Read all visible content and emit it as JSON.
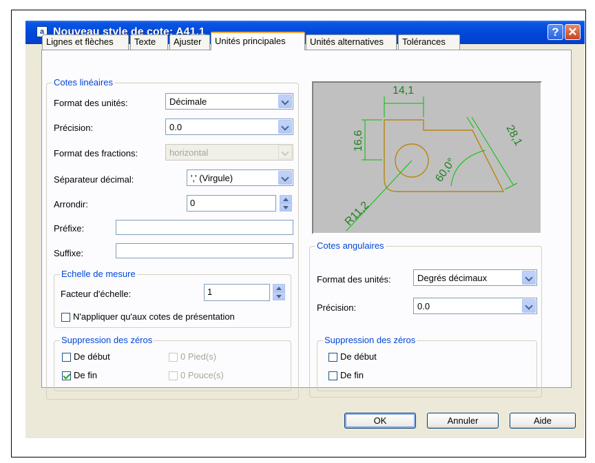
{
  "window": {
    "title": "Nouveau style de cote: A41.1",
    "help_btn": "?",
    "close_btn": "✕",
    "icon_text": "a"
  },
  "tabs": [
    {
      "label": "Lignes et flèches"
    },
    {
      "label": "Texte"
    },
    {
      "label": "Ajuster"
    },
    {
      "label": "Unités principales",
      "active": true
    },
    {
      "label": "Unités alternatives"
    },
    {
      "label": "Tolérances"
    }
  ],
  "linear": {
    "legend": "Cotes linéaires",
    "unit_format_label": "Format des unités:",
    "unit_format_value": "Décimale",
    "precision_label": "Précision:",
    "precision_value": "0.0",
    "fraction_label": "Format des fractions:",
    "fraction_value": "horizontal",
    "decimal_sep_label": "Séparateur décimal:",
    "decimal_sep_value": "',' (Virgule)",
    "round_label": "Arrondir:",
    "round_value": "0",
    "prefix_label": "Préfixe:",
    "prefix_value": "",
    "suffix_label": "Suffixe:",
    "suffix_value": ""
  },
  "scale": {
    "legend": "Echelle de mesure",
    "factor_label": "Facteur d'échelle:",
    "factor_value": "1",
    "layout_only_label": "N'appliquer qu'aux cotes de présentation",
    "layout_only_checked": false
  },
  "linear_zero": {
    "legend": "Suppression des zéros",
    "leading_label": "De début",
    "leading_checked": false,
    "trailing_label": "De fin",
    "trailing_checked": true,
    "feet_label": "0 Pied(s)",
    "inches_label": "0 Pouce(s)"
  },
  "preview": {
    "dim_top": "14,1",
    "dim_left": "16,6",
    "dim_right": "28,1",
    "dim_angle": "60,0°",
    "dim_radius": "R11,2",
    "geometry_color": "#b8860b",
    "dimension_color": "#00c000",
    "text_color": "#1e7f1e"
  },
  "angular": {
    "legend": "Cotes angulaires",
    "unit_format_label": "Format des unités:",
    "unit_format_value": "Degrés décimaux",
    "precision_label": "Précision:",
    "precision_value": "0.0"
  },
  "angular_zero": {
    "legend": "Suppression des zéros",
    "leading_label": "De début",
    "leading_checked": false,
    "trailing_label": "De fin",
    "trailing_checked": false
  },
  "buttons": {
    "ok": "OK",
    "cancel": "Annuler",
    "help": "Aide"
  }
}
